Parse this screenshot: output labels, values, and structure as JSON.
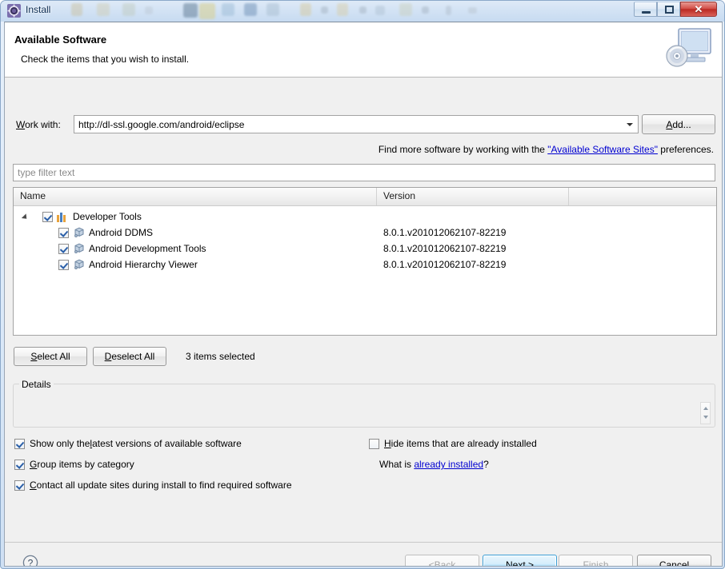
{
  "window": {
    "title": "Install",
    "title_icon": "install-gear-icon",
    "controls": {
      "minimize": "minimize-button",
      "maximize": "maximize-button",
      "close_label": "✕"
    }
  },
  "header": {
    "title": "Available Software",
    "subtitle": "Check the items that you wish to install.",
    "banner_icon": "monitor-disc-icon"
  },
  "work_with": {
    "label_prefix": "W",
    "label_rest": "ork with:",
    "value": "http://dl-ssl.google.com/android/eclipse",
    "add_button_prefix": "A",
    "add_button_rest": "dd..."
  },
  "hint": {
    "before": "Find more software by working with the ",
    "link": "\"Available Software Sites\"",
    "after": " preferences."
  },
  "filter": {
    "placeholder": "type filter text",
    "value": ""
  },
  "table": {
    "columns": [
      "Name",
      "Version",
      ""
    ],
    "rows": [
      {
        "name": "Developer Tools",
        "version": "",
        "checked": true,
        "level": 0,
        "icon": "category-icon",
        "expanded": true
      },
      {
        "name": "Android DDMS",
        "version": "8.0.1.v201012062107-82219",
        "checked": true,
        "level": 1,
        "icon": "installable-unit-icon",
        "expanded": false
      },
      {
        "name": "Android Development Tools",
        "version": "8.0.1.v201012062107-82219",
        "checked": true,
        "level": 1,
        "icon": "installable-unit-icon",
        "expanded": false
      },
      {
        "name": "Android Hierarchy Viewer",
        "version": "8.0.1.v201012062107-82219",
        "checked": true,
        "level": 1,
        "icon": "installable-unit-icon",
        "expanded": false
      }
    ]
  },
  "selection": {
    "select_all_prefix": "S",
    "select_all_rest": "elect All",
    "deselect_all_prefix": "D",
    "deselect_all_rest": "eselect All",
    "status": "3 items selected"
  },
  "details": {
    "legend": "Details",
    "content": ""
  },
  "options": {
    "show_latest": {
      "before": "Show only the ",
      "mnemonic": "l",
      "after": "atest versions of available software",
      "checked": true
    },
    "group_by_category": {
      "before": "",
      "mnemonic": "G",
      "after": "roup items by category",
      "checked": true
    },
    "contact_all_sites": {
      "before": "",
      "mnemonic": "C",
      "after": "ontact all update sites during install to find required software",
      "checked": true
    },
    "hide_installed": {
      "before": "",
      "mnemonic": "H",
      "after": "ide items that are already installed",
      "checked": false
    },
    "what_is": {
      "before": "What is ",
      "link": "already installed",
      "after": "?"
    }
  },
  "footer": {
    "help_icon": "help-question-icon",
    "back": {
      "before": "< ",
      "mnemonic": "B",
      "after": "ack",
      "enabled": false
    },
    "next": {
      "before": "",
      "mnemonic": "N",
      "after": "ext >",
      "enabled": true,
      "default": true
    },
    "finish": {
      "before": "",
      "mnemonic": "F",
      "after": "inish",
      "enabled": false
    },
    "cancel": {
      "before": "",
      "mnemonic": "",
      "after": "Cancel",
      "enabled": true
    }
  },
  "colors": {
    "title_bar": "#d2e2f4",
    "dialog_bg": "#f0f0f0",
    "link": "#0000d0",
    "close_button": "#bb2a23",
    "default_button_border": "#3c9fd6",
    "category_icon_bars": [
      "#e8a33d",
      "#4a7fbf",
      "#e8a33d"
    ]
  }
}
